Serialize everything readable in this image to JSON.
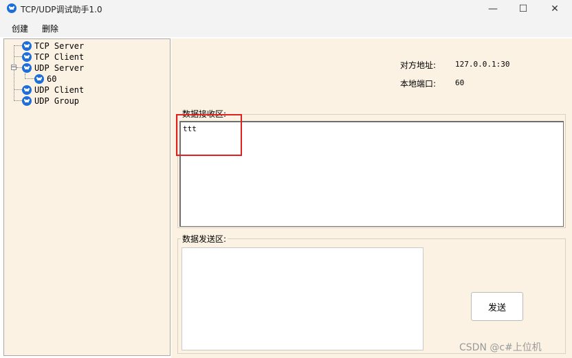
{
  "window": {
    "title": "TCP/UDP调试助手1.0",
    "minimize": "—",
    "maximize": "☐",
    "close": "✕"
  },
  "menu": {
    "items": [
      "创建",
      "删除"
    ]
  },
  "tree": {
    "nodes": [
      {
        "label": "TCP Server"
      },
      {
        "label": "TCP Client"
      },
      {
        "label": "UDP Server",
        "expander": "−",
        "children": [
          {
            "label": "60"
          }
        ]
      },
      {
        "label": "UDP Client"
      },
      {
        "label": "UDP Group"
      }
    ]
  },
  "info": {
    "remote_label": "对方地址:",
    "remote_value": "127.0.0.1:30",
    "local_label": "本地端口:",
    "local_value": "60"
  },
  "receive": {
    "label": "数据接收区:",
    "content": "ttt"
  },
  "send": {
    "label": "数据发送区:",
    "content": "",
    "button": "发送"
  },
  "watermark": "CSDN @c#上位机",
  "colors": {
    "panel": "#fbf2e3",
    "icon": "#1e6fd9",
    "highlight": "#e21f1f"
  }
}
